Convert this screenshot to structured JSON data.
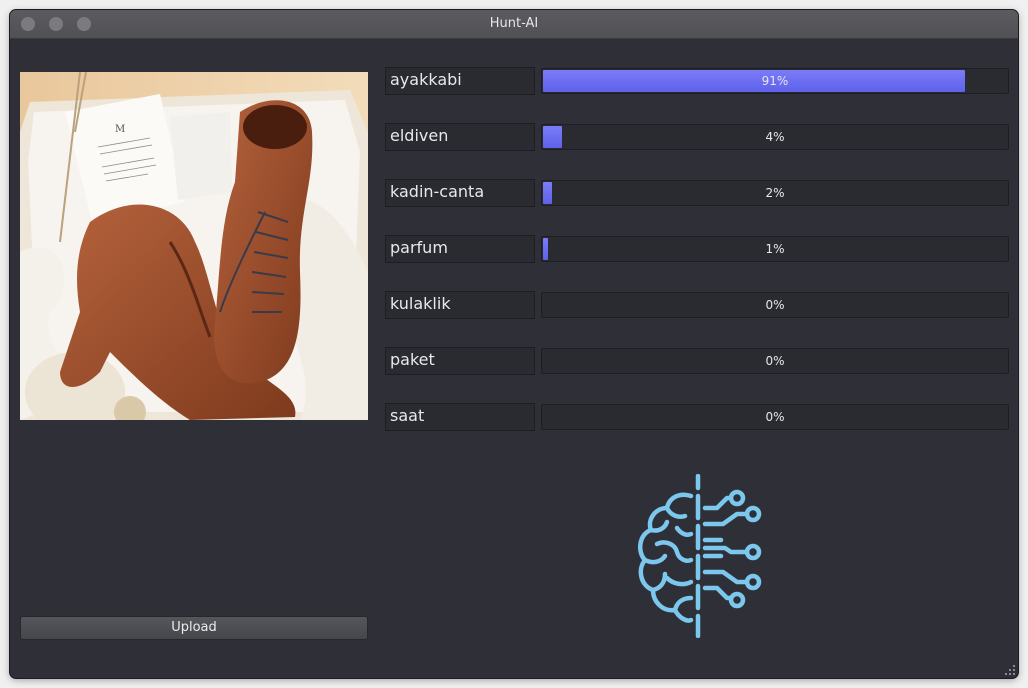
{
  "window": {
    "title": "Hunt-AI"
  },
  "predictions": [
    {
      "label": "ayakkabi",
      "percent_text": "91%",
      "value": 0.91
    },
    {
      "label": "eldiven",
      "percent_text": "4%",
      "value": 0.04
    },
    {
      "label": "kadin-canta",
      "percent_text": "2%",
      "value": 0.02
    },
    {
      "label": "parfum",
      "percent_text": "1%",
      "value": 0.01
    },
    {
      "label": "kulaklik",
      "percent_text": "0%",
      "value": 0.0
    },
    {
      "label": "paket",
      "percent_text": "0%",
      "value": 0.0
    },
    {
      "label": "saat",
      "percent_text": "0%",
      "value": 0.0
    }
  ],
  "upload_button": {
    "label": "Upload"
  },
  "logo": {
    "icon": "ai-brain-icon",
    "color": "#7cc7ee"
  },
  "colors": {
    "bar_fill": "#6a6cf2",
    "background": "#2f3037"
  }
}
